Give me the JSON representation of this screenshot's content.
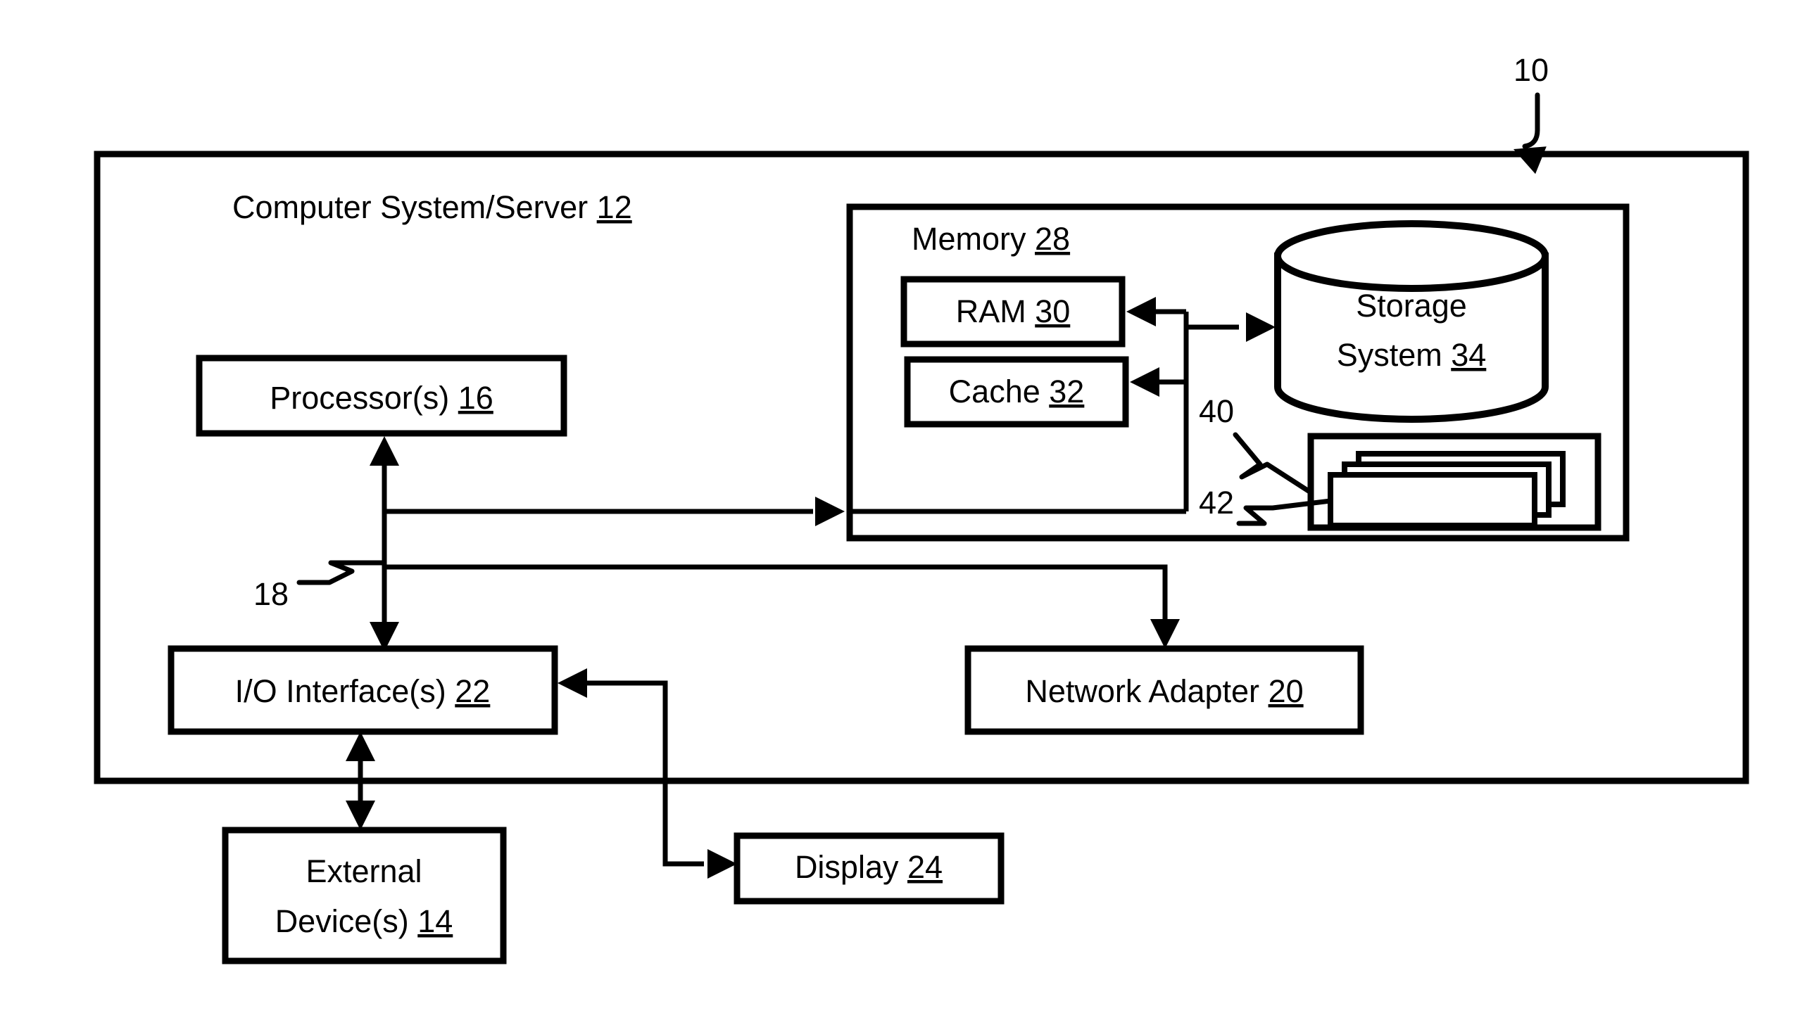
{
  "figure": {
    "reference_numeral": "10",
    "outer_box_label": "Computer System/Server",
    "outer_box_number": "12"
  },
  "blocks": {
    "processor": {
      "label": "Processor(s)",
      "number": "16"
    },
    "io_interface": {
      "label": "I/O Interface(s)",
      "number": "22"
    },
    "external_device": {
      "label_line1": "External",
      "label_line2": "Device(s)",
      "number": "14"
    },
    "display": {
      "label": "Display",
      "number": "24"
    },
    "network_adapter": {
      "label": "Network Adapter",
      "number": "20"
    },
    "memory": {
      "label": "Memory",
      "number": "28"
    },
    "ram": {
      "label": "RAM",
      "number": "30"
    },
    "cache": {
      "label": "Cache",
      "number": "32"
    },
    "storage_system": {
      "label_line1": "Storage",
      "label_line2": "System",
      "number": "34"
    },
    "program_container": {
      "number": "40"
    },
    "program_modules": {
      "number": "42"
    },
    "bus": {
      "number": "18"
    }
  },
  "colors": {
    "stroke": "#000000",
    "background": "#ffffff"
  }
}
